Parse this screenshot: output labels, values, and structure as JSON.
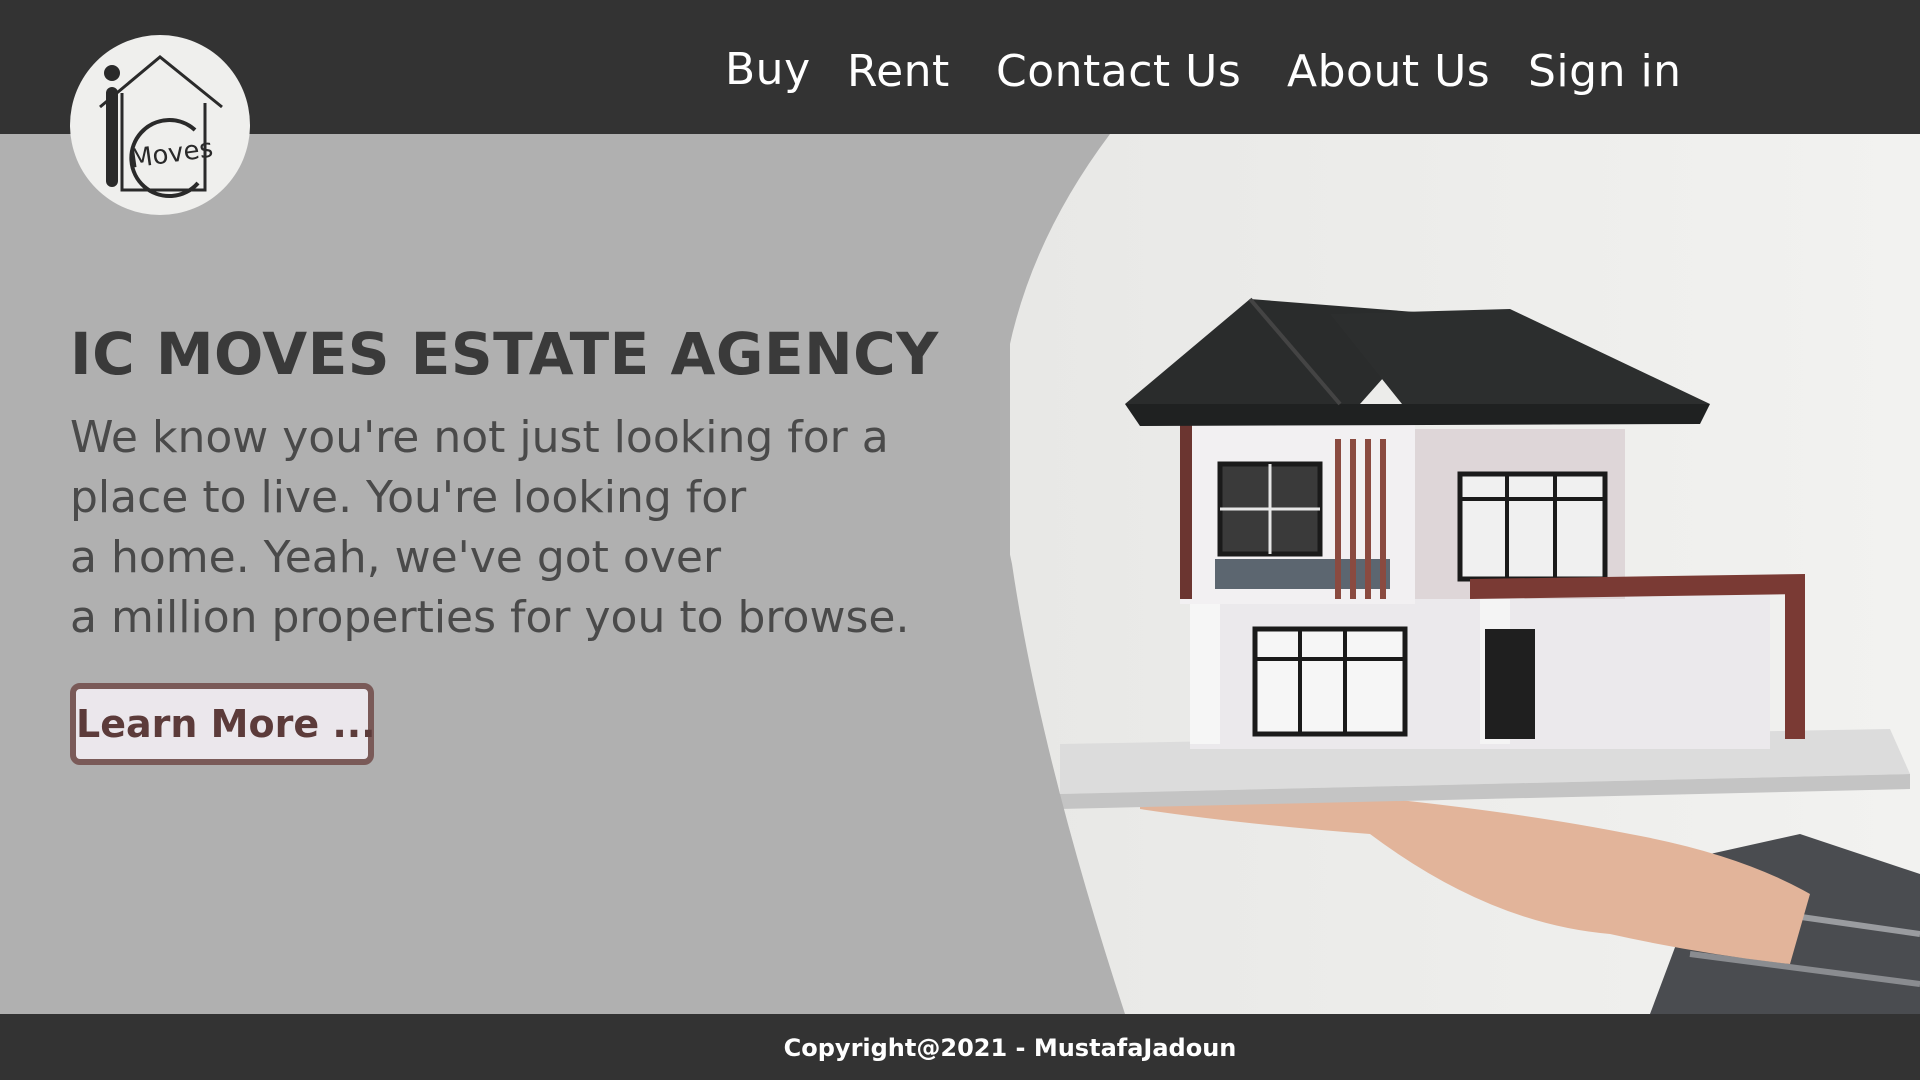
{
  "nav": {
    "items": [
      {
        "label": "Buy"
      },
      {
        "label": "Rent"
      },
      {
        "label": "Contact Us"
      },
      {
        "label": "About Us"
      },
      {
        "label": "Sign in"
      }
    ]
  },
  "logo": {
    "letter": "i",
    "text": "Moves"
  },
  "hero": {
    "title": "IC MOVES ESTATE AGENCY",
    "lines": [
      "We know you're not just looking for a",
      "place to live. You're looking for",
      "a home. Yeah, we've got over",
      "a million properties for you to browse."
    ],
    "button_label": "Learn More ..."
  },
  "footer": {
    "copyright": "Copyright@2021 - MustafaJadoun"
  },
  "colors": {
    "header_bg": "#333333",
    "panel_gray": "#b0b0b0",
    "button_border": "#7a5a58",
    "button_text": "#5c3b3a",
    "title_text": "#3a3a3a"
  },
  "icons": {
    "logo": "house-logo-icon"
  }
}
